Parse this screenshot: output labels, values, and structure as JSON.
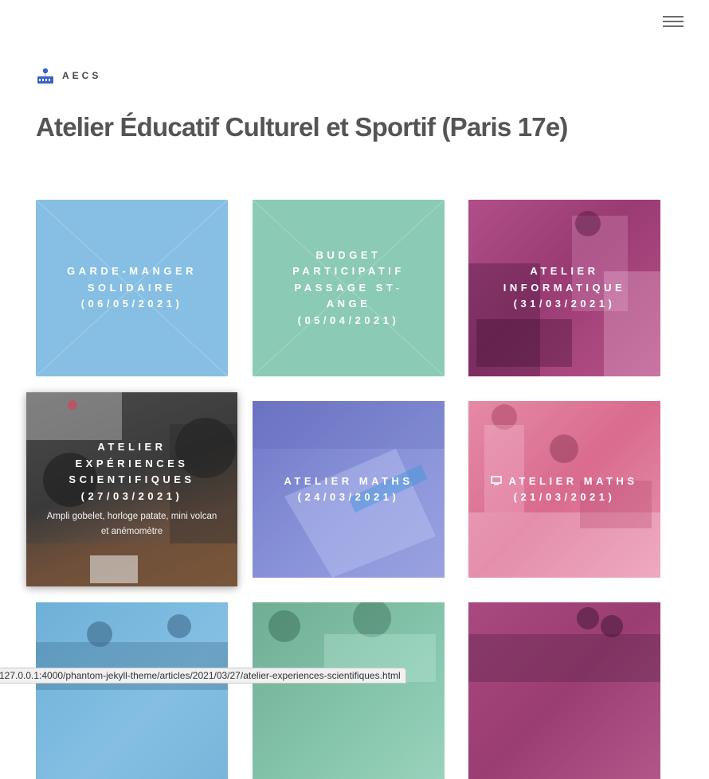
{
  "header": {
    "menu_icon": "hamburger-menu-icon"
  },
  "logo": {
    "icon": "aecs-logo-icon",
    "text": "AECS"
  },
  "page": {
    "title": "Atelier Éducatif Culturel et Sportif (Paris 17e)"
  },
  "colors": {
    "blue": "#86bfe3",
    "green": "#8bcab5",
    "magenta": "#b0457f",
    "indigo": "#7d88d1",
    "pink": "#e07e9e",
    "dark": "#3c3c3c"
  },
  "tiles": [
    {
      "title": "Garde-manger solidaire (06/05/2021)",
      "description": "",
      "icon": ""
    },
    {
      "title": "Budget participatif Passage St-Ange (05/04/2021)",
      "description": "",
      "icon": ""
    },
    {
      "title": "Atelier informatique (31/03/2021)",
      "description": "",
      "icon": ""
    },
    {
      "title": "Atelier expériences scientifiques (27/03/2021)",
      "description": "Ampli gobelet, horloge patate, mini volcan et anémomètre",
      "icon": ""
    },
    {
      "title": "Atelier maths (24/03/2021)",
      "description": "",
      "icon": ""
    },
    {
      "title": "Atelier maths (21/03/2021)",
      "description": "",
      "icon": "monitor-icon"
    },
    {
      "title": "",
      "description": "",
      "icon": ""
    },
    {
      "title": "",
      "description": "",
      "icon": ""
    },
    {
      "title": "",
      "description": "",
      "icon": ""
    }
  ],
  "status_bar": {
    "url": "127.0.0.1:4000/phantom-jekyll-theme/articles/2021/03/27/atelier-experiences-scientifiques.html"
  }
}
